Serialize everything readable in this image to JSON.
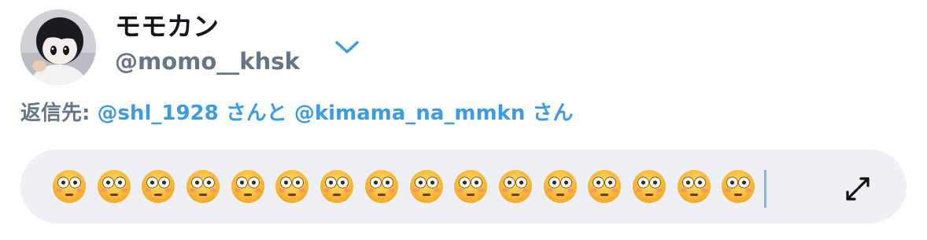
{
  "header": {
    "display_name": "モモカン",
    "handle": "@momo__khsk",
    "avatar_icon": "avatar-plush-doll",
    "account_switch_icon": "chevron-down-icon"
  },
  "reply": {
    "prefix": "返信先: ",
    "mention_1": "@shl_1928",
    "joiner": " さんと ",
    "mention_2": "@kimama_na_mmkn",
    "suffix": " さん"
  },
  "compose": {
    "emoji_name": "flushed-face",
    "emoji_count": 16,
    "expand_icon": "expand-arrows-icon"
  },
  "colors": {
    "accent": "#3d9be0",
    "secondary_text": "#657786",
    "compose_bg": "#eef0f3"
  }
}
